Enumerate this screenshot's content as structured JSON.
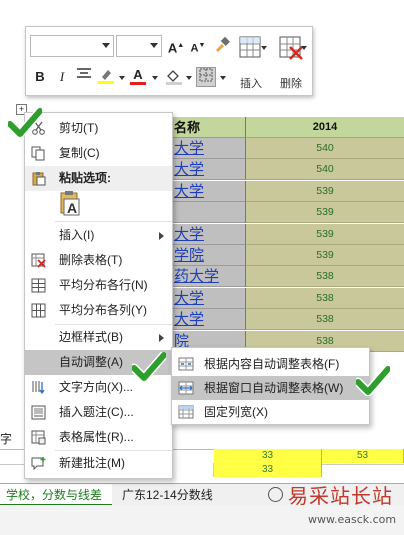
{
  "table": {
    "header_name": "名称",
    "header_year": "2014",
    "rows": [
      {
        "name": "大学",
        "value": "540"
      },
      {
        "name": "大学",
        "value": "540"
      },
      {
        "name": "大学",
        "value": "539"
      },
      {
        "name": "",
        "value": "539"
      },
      {
        "name": "大学",
        "value": "539"
      },
      {
        "name": "学院",
        "value": "539"
      },
      {
        "name": "药大学",
        "value": "538"
      },
      {
        "name": "大学",
        "value": "538"
      },
      {
        "name": "大学",
        "value": "538"
      },
      {
        "name": "院",
        "value": "538"
      }
    ],
    "cut_char": "字",
    "bottom_value_1": "33",
    "bottom_value_2": "53",
    "bottom_value_3": "33",
    "bottom_left_value": "33"
  },
  "sheet_tabs": {
    "active": "学校，分数与线差",
    "next": "广东12-14分数线"
  },
  "mini_toolbar": {
    "bold": "B",
    "italic": "I",
    "insert_label": "插入",
    "delete_label": "删除",
    "grow_font": "A",
    "shrink_font": "A",
    "font_color_letter": "A"
  },
  "context_menu": {
    "items": [
      {
        "label": "剪切(T)"
      },
      {
        "label": "复制(C)"
      },
      {
        "label": "粘贴选项:"
      },
      {
        "label": "插入(I)"
      },
      {
        "label": "删除表格(T)"
      },
      {
        "label": "平均分布各行(N)"
      },
      {
        "label": "平均分布各列(Y)"
      },
      {
        "label": "边框样式(B)"
      },
      {
        "label": "自动调整(A)"
      },
      {
        "label": "文字方向(X)..."
      },
      {
        "label": "插入题注(C)..."
      },
      {
        "label": "表格属性(R)..."
      },
      {
        "label": "新建批注(M)"
      }
    ],
    "paste_icon_letter": "A"
  },
  "autofit_submenu": {
    "items": [
      {
        "label": "根据内容自动调整表格(F)"
      },
      {
        "label": "根据窗口自动调整表格(W)"
      },
      {
        "label": "固定列宽(X)"
      }
    ]
  },
  "watermark": {
    "title": "易采站长站",
    "url": "www.easck.com"
  },
  "colors": {
    "check_green": "#2e9e2e",
    "highlight_grey": "#c5c5c5",
    "cell_grey": "#bfbfbf",
    "cell_olive": "#c8c89a",
    "header_green": "#c3d69b"
  }
}
